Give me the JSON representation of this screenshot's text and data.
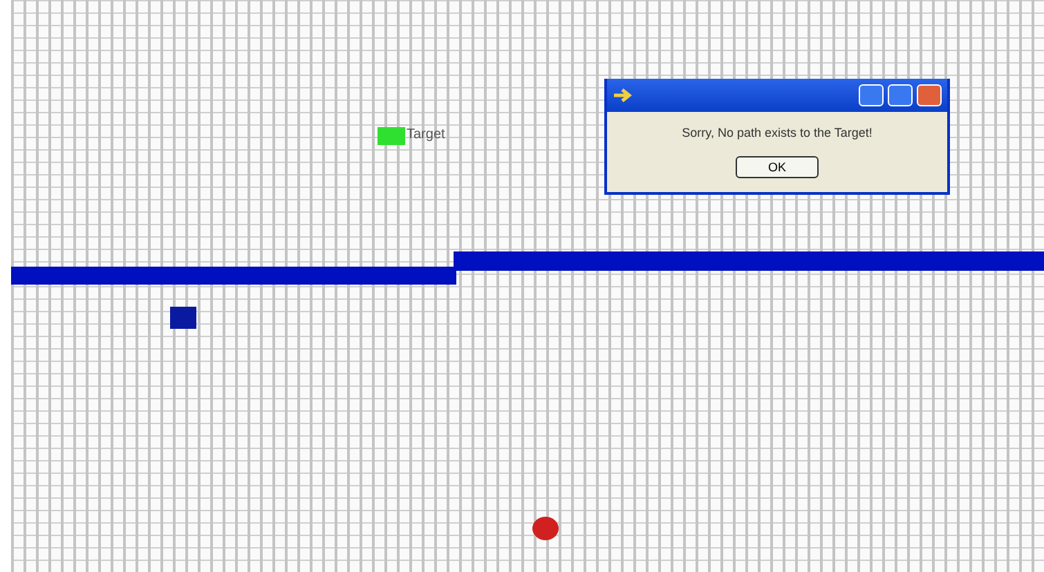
{
  "canvas": {
    "markers": [
      {
        "kind": "target",
        "label": "Target"
      },
      {
        "kind": "block"
      },
      {
        "kind": "robot"
      }
    ],
    "walls": [
      {
        "kind": "step"
      }
    ]
  },
  "dialog": {
    "message": "Sorry, No path exists to the Target!",
    "buttons": [
      "OK"
    ]
  }
}
